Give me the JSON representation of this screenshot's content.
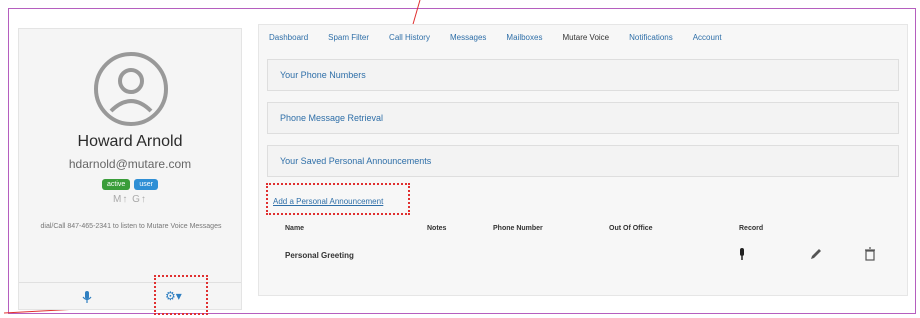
{
  "profile": {
    "name": "Howard Arnold",
    "email": "hdarnold@mutare.com",
    "badges": [
      "active",
      "user"
    ],
    "codes": "M↑  G↑",
    "help": "dial/Call 847-465-2341 to listen to Mutare Voice Messages"
  },
  "tabs": [
    "Dashboard",
    "Spam Filter",
    "Call History",
    "Messages",
    "Mailboxes",
    "Mutare Voice",
    "Notifications",
    "Account"
  ],
  "active_tab": "Mutare Voice",
  "sections": [
    "Your Phone Numbers",
    "Phone Message Retrieval",
    "Your Saved Personal Announcements"
  ],
  "add_link": "Add a Personal Announcement",
  "table": {
    "headers": [
      "Name",
      "Notes",
      "Phone Number",
      "Out Of Office",
      "Record"
    ],
    "rows": [
      {
        "name": "Personal Greeting"
      }
    ]
  },
  "colors": {
    "annotation": "#e03030",
    "frame": "#b55fbf",
    "link": "#2f6fa8"
  }
}
